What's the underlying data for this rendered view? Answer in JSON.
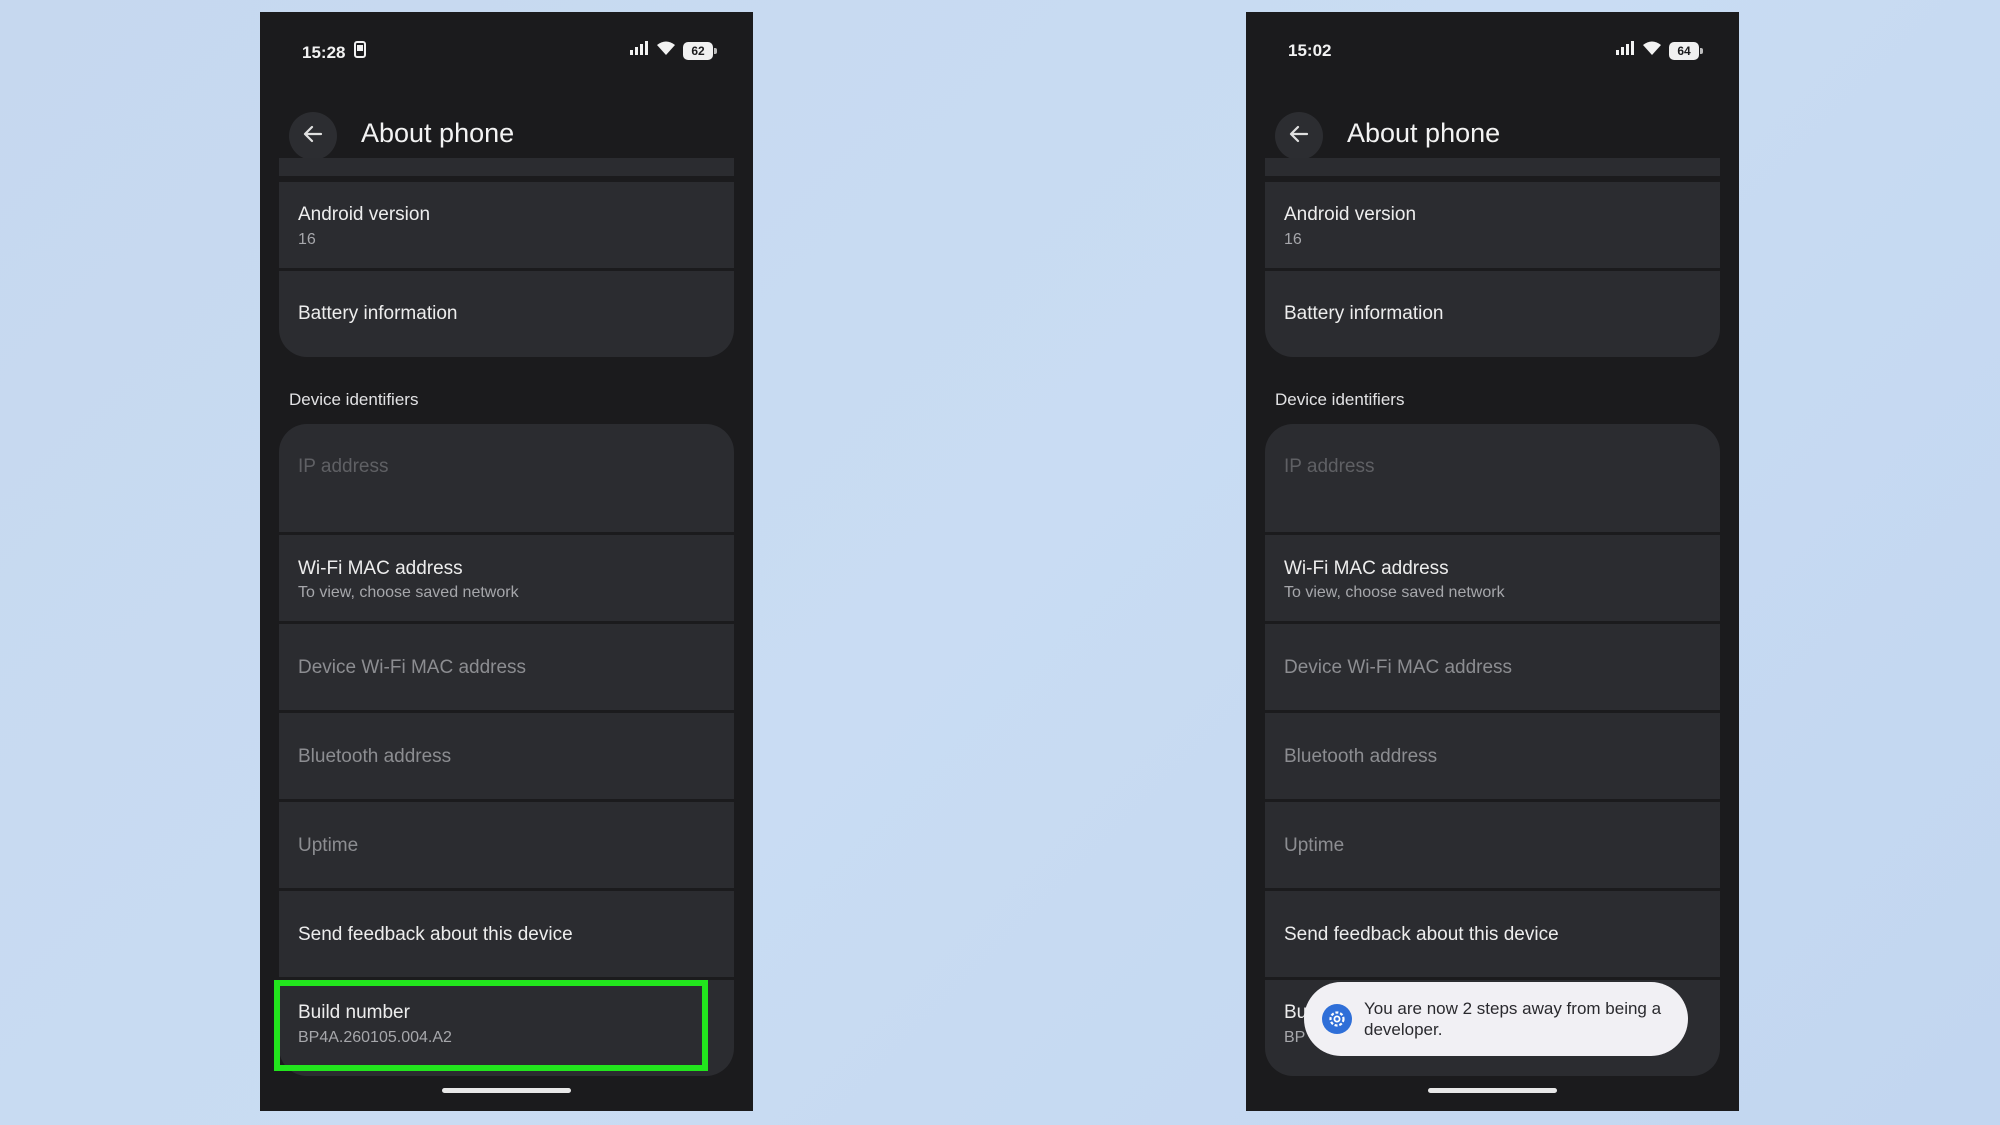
{
  "left_phone": {
    "status": {
      "time": "15:28",
      "battery": "62"
    },
    "title": "About phone",
    "items": {
      "android_version": {
        "title": "Android version",
        "value": "16"
      },
      "battery_info": {
        "title": "Battery information"
      },
      "section_header": "Device identifiers",
      "ip_address": {
        "title": "IP address"
      },
      "wifi_mac": {
        "title": "Wi-Fi MAC address",
        "value": "To view, choose saved network"
      },
      "device_wifi_mac": {
        "title": "Device Wi-Fi MAC address"
      },
      "bluetooth": {
        "title": "Bluetooth address"
      },
      "uptime": {
        "title": "Uptime"
      },
      "feedback": {
        "title": "Send feedback about this device"
      },
      "build_number": {
        "title": "Build number",
        "value": "BP4A.260105.004.A2"
      }
    },
    "highlight_color": "#22e51d"
  },
  "right_phone": {
    "status": {
      "time": "15:02",
      "battery": "64"
    },
    "title": "About phone",
    "items": {
      "android_version": {
        "title": "Android version",
        "value": "16"
      },
      "battery_info": {
        "title": "Battery information"
      },
      "section_header": "Device identifiers",
      "ip_address": {
        "title": "IP address"
      },
      "wifi_mac": {
        "title": "Wi-Fi MAC address",
        "value": "To view, choose saved network"
      },
      "device_wifi_mac": {
        "title": "Device Wi-Fi MAC address"
      },
      "bluetooth": {
        "title": "Bluetooth address"
      },
      "uptime": {
        "title": "Uptime"
      },
      "feedback": {
        "title": "Send feedback about this device"
      },
      "build_number_partial": {
        "title": "Bu",
        "value": "BP"
      }
    },
    "toast": {
      "text": "You are now 2 steps away from being a developer.",
      "icon": "settings-gear-icon"
    }
  },
  "icons": {
    "back": "arrow-left-icon",
    "signal": "signal-bars-icon",
    "wifi": "wifi-icon",
    "screen": "phone-screen-icon"
  }
}
